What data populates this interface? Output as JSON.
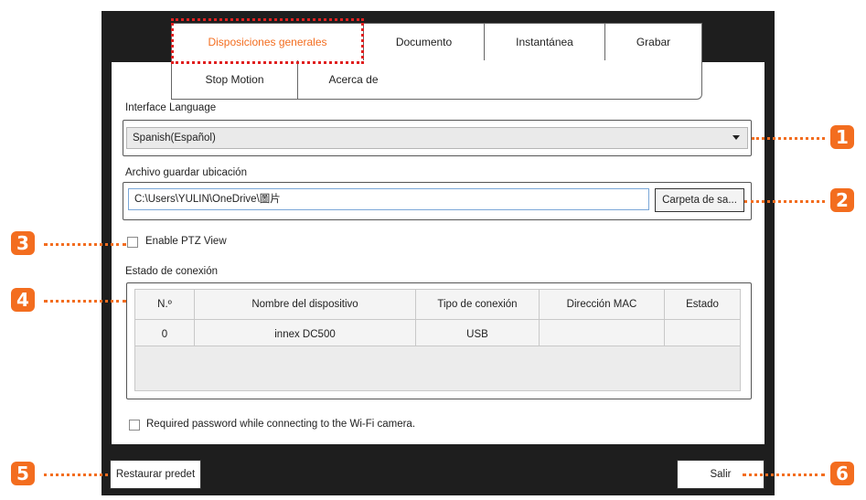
{
  "tabs_row1": [
    "Disposiciones generales",
    "Documento",
    "Instantánea",
    "Grabar"
  ],
  "tabs_row2": [
    "Stop Motion",
    "Acerca de"
  ],
  "active_tab": "Disposiciones generales",
  "language": {
    "label": "Interface Language",
    "value": "Spanish(Español)"
  },
  "save_location": {
    "label": "Archivo guardar ubicación",
    "path": "C:\\Users\\YULIN\\OneDrive\\圖片",
    "browse_button": "Carpeta de sa..."
  },
  "ptz": {
    "label": "Enable PTZ View",
    "checked": false
  },
  "connection": {
    "label": "Estado de conexión",
    "columns": [
      "N.º",
      "Nombre del dispositivo",
      "Tipo de conexión",
      "Dirección MAC",
      "Estado"
    ],
    "rows": [
      [
        "0",
        "innex DC500",
        "USB",
        "",
        ""
      ]
    ]
  },
  "wifi_password": {
    "label": "Required password while connecting to the Wi-Fi camera.",
    "checked": false
  },
  "buttons": {
    "restore": "Restaurar predet",
    "exit": "Salir"
  },
  "callouts": [
    "1",
    "2",
    "3",
    "4",
    "5",
    "6"
  ],
  "colors": {
    "accent": "#f36d1f",
    "highlight": "#e02020",
    "frame": "#1e1e1e"
  }
}
